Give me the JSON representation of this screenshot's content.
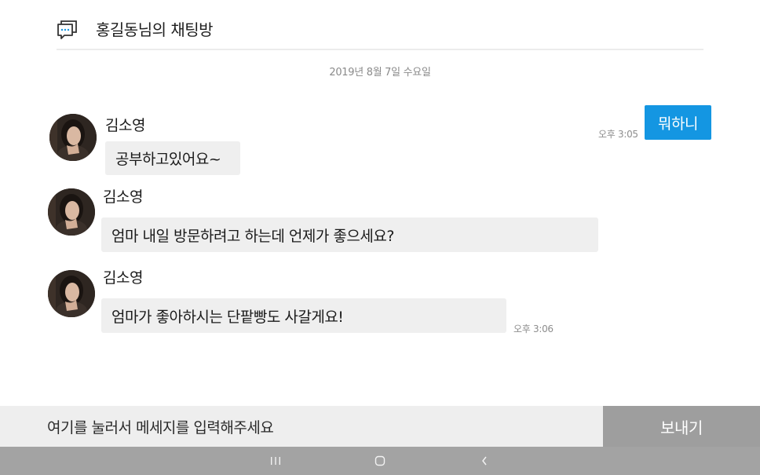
{
  "header": {
    "title": "홍길동님의 채팅방",
    "icon": "chat-bubble-icon"
  },
  "date": "2019년 8월 7일 수요일",
  "messages": [
    {
      "sender": "김소영",
      "text": "공부하고있어요~"
    },
    {
      "sender": "김소영",
      "text": "엄마 내일 방문하려고 하는데 언제가 좋으세요?"
    },
    {
      "sender": "김소영",
      "text": "엄마가 좋아하시는 단팥빵도 사갈게요!",
      "time": "오후 3:06"
    }
  ],
  "my_message": {
    "text": "뭐하니",
    "time": "오후 3:05"
  },
  "input": {
    "placeholder": "여기를 눌러서 메세지를 입력해주세요"
  },
  "send_button": {
    "label": "보내기"
  },
  "nav": {
    "recent": "recent-apps-icon",
    "home": "home-icon",
    "back": "back-icon"
  },
  "colors": {
    "accent": "#1496e2",
    "bubble": "#efefef",
    "send_bg": "#9e9e9e",
    "nav_bg": "#a3a3a3"
  }
}
